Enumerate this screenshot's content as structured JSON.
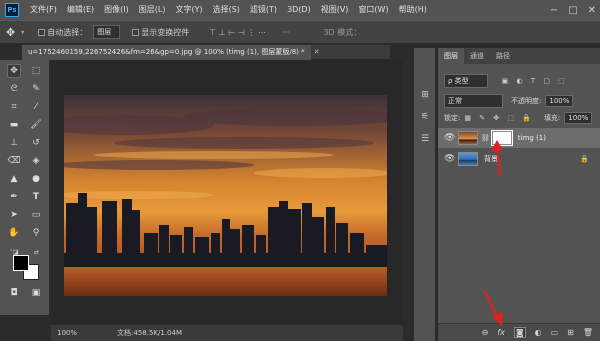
{
  "app": {
    "logo": "Ps"
  },
  "menu": [
    "文件(F)",
    "编辑(E)",
    "图像(I)",
    "图层(L)",
    "文字(Y)",
    "选择(S)",
    "滤镜(T)",
    "3D(D)",
    "视图(V)",
    "窗口(W)",
    "帮助(H)"
  ],
  "window_controls": {
    "minimize": "−",
    "maximize": "□",
    "close": "✕"
  },
  "options": {
    "move_glyph": "✥",
    "auto_select_label": "自动选择：",
    "auto_select_value": "图层",
    "show_transform_label": "显示变换控件",
    "align_icons": "⊤ ⊥ ⊢ ⊣ ⋮ ⋯",
    "more": "···",
    "mode_3d": "3D 模式："
  },
  "document": {
    "tab_title": "u=1752460159,226752426&fm=26&gp=0.jpg @ 100% (timg (1), 图层蒙版/8) *",
    "zoom": "100%",
    "doc_info": "文档:458.5K/1.04M"
  },
  "layers_panel": {
    "tabs": [
      "图层",
      "通道",
      "路径"
    ],
    "filter_kind": "ρ 类型",
    "blend_mode": "正常",
    "opacity_label": "不透明度:",
    "opacity_value": "100%",
    "lock_label": "锁定:",
    "fill_label": "填充:",
    "fill_value": "100%",
    "layers": [
      {
        "name": "timg (1)",
        "visible": true,
        "selected": true,
        "has_mask": true
      },
      {
        "name": "背景",
        "visible": true,
        "selected": false,
        "locked": true
      }
    ],
    "bottom_icons": [
      "link-icon",
      "fx-icon",
      "add-mask-icon",
      "adjustment-icon",
      "group-icon",
      "new-layer-icon",
      "trash-icon"
    ],
    "bottom_labels": {
      "link": "⊖",
      "fx": "fx",
      "mask": "◙",
      "adjust": "◐",
      "group": "▭",
      "new": "⊞",
      "trash": "🗑"
    }
  },
  "colors": {
    "accent_arrow": "#e0201a",
    "ps_blue": "#31a8ff"
  }
}
